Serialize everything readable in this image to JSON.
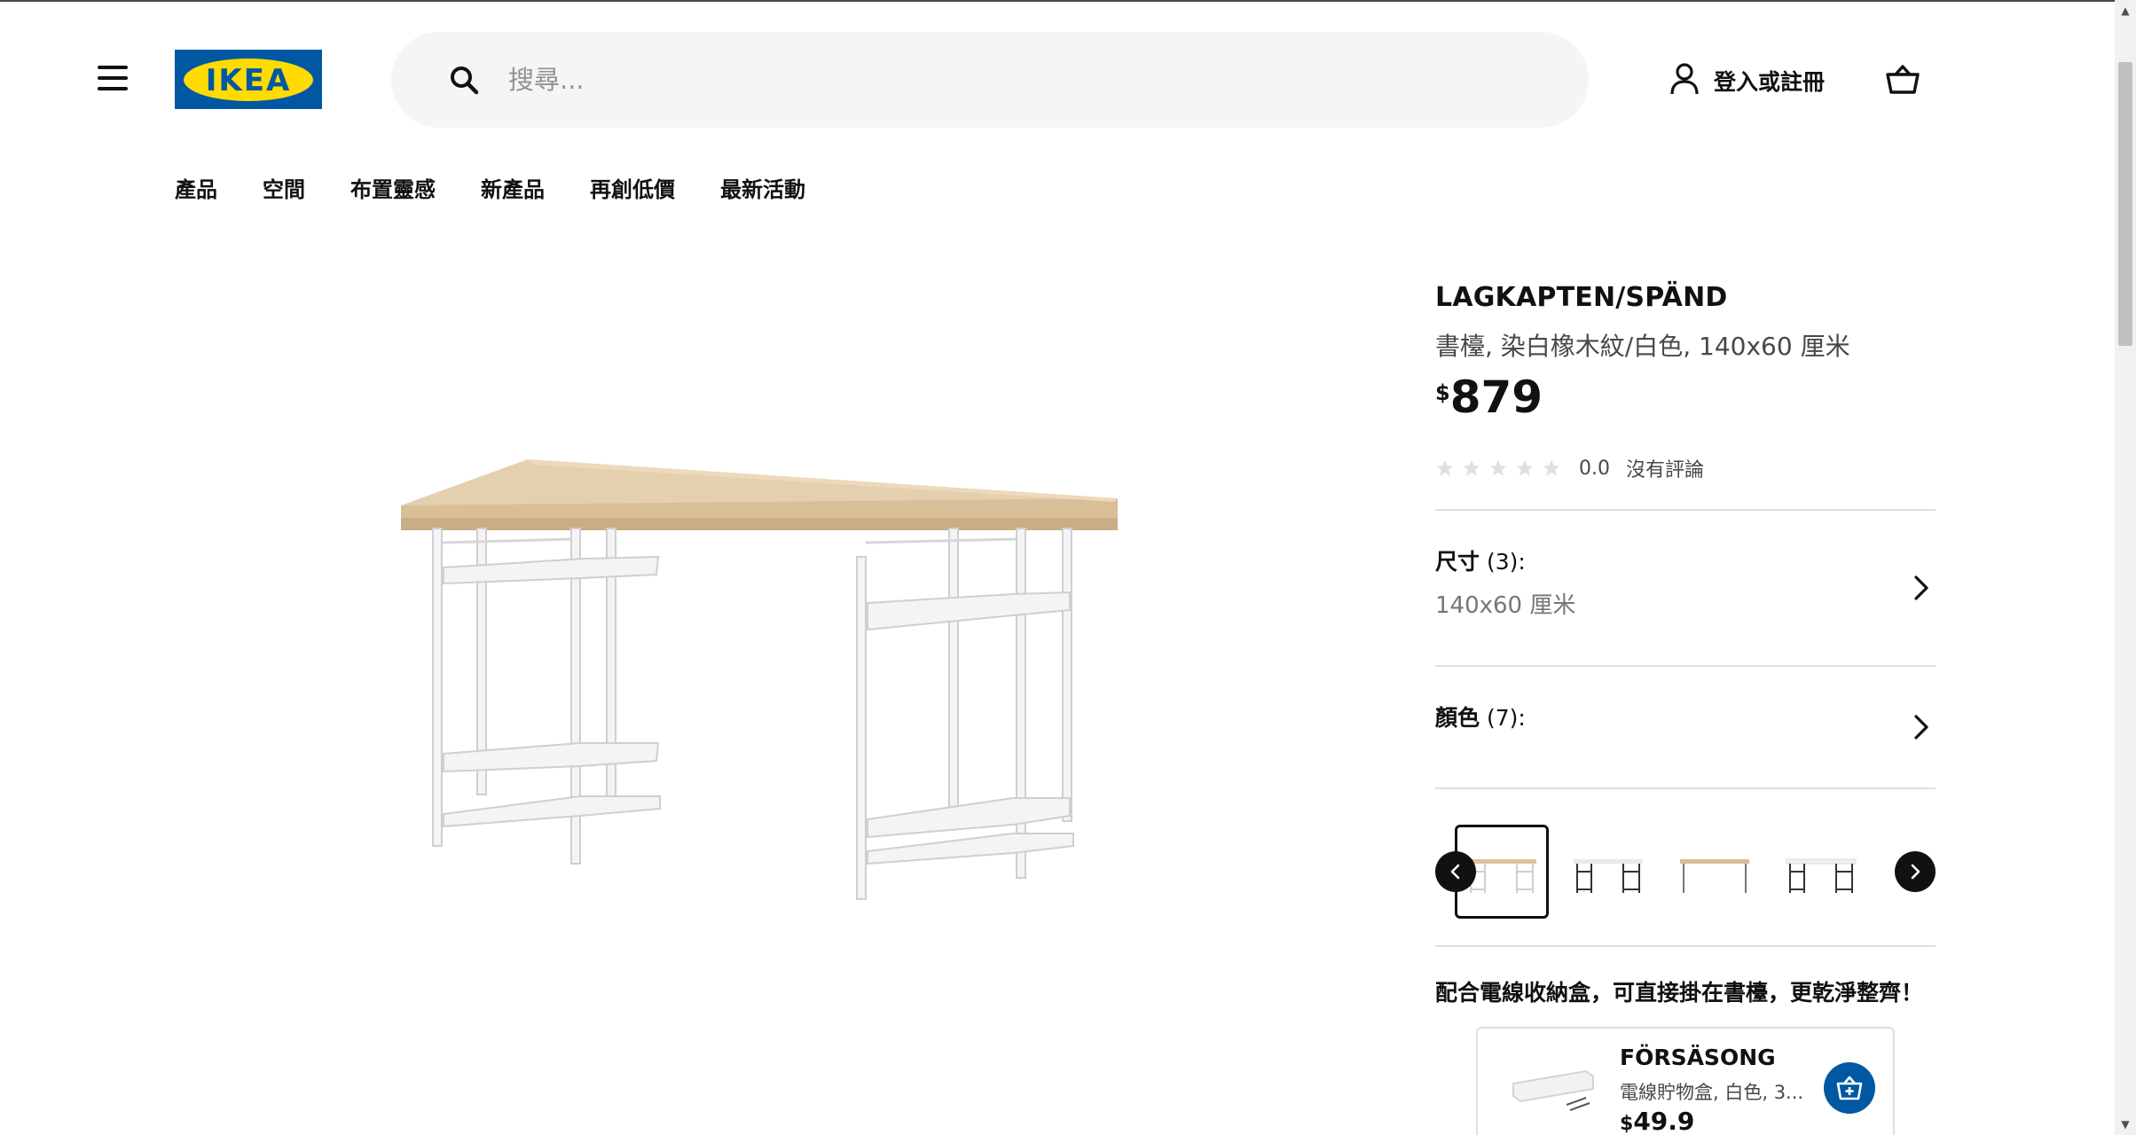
{
  "header": {
    "logo_text": "IKEA",
    "search": {
      "placeholder": "搜尋..."
    },
    "account_label": "登入或註冊"
  },
  "nav": {
    "items": [
      {
        "label": "產品"
      },
      {
        "label": "空間"
      },
      {
        "label": "布置靈感"
      },
      {
        "label": "新產品"
      },
      {
        "label": "再創低價"
      },
      {
        "label": "最新活動"
      }
    ]
  },
  "product": {
    "name": "LAGKAPTEN/SPÄND",
    "description": "書檯, 染白橡木紋/白色, 140x60 厘米",
    "price_currency": "$",
    "price_value": "879",
    "rating": {
      "score": "0.0",
      "text": "沒有評論",
      "stars_filled": 0,
      "stars_total": 5
    },
    "options": {
      "size": {
        "label": "尺寸",
        "count": "(3):",
        "value": "140x60 厘米"
      },
      "color": {
        "label": "顏色",
        "count": "(7):"
      }
    },
    "thumbnails": [
      {
        "name": "oak-white-desk",
        "selected": true
      },
      {
        "name": "black-desk-1",
        "selected": false
      },
      {
        "name": "oak-black-desk",
        "selected": false
      },
      {
        "name": "white-black-desk",
        "selected": false
      }
    ]
  },
  "promo": {
    "text": "配合電線收納盒，可直接掛在書檯，更乾淨整齊！",
    "card": {
      "name": "FÖRSÄSONG",
      "description": "電線貯物盒, 白色, 3...",
      "price_currency": "$",
      "price_value": "49.9"
    }
  },
  "colors": {
    "ikea_blue": "#0058a3",
    "ikea_yellow": "#ffdb00",
    "text_primary": "#111111",
    "text_secondary": "#484848",
    "text_muted": "#767676",
    "search_bg": "#f5f5f5"
  },
  "icons": [
    "hamburger-icon",
    "search-icon",
    "user-icon",
    "basket-icon",
    "star-icon",
    "chevron-right-icon",
    "chevron-left-icon",
    "add-to-cart-icon"
  ]
}
